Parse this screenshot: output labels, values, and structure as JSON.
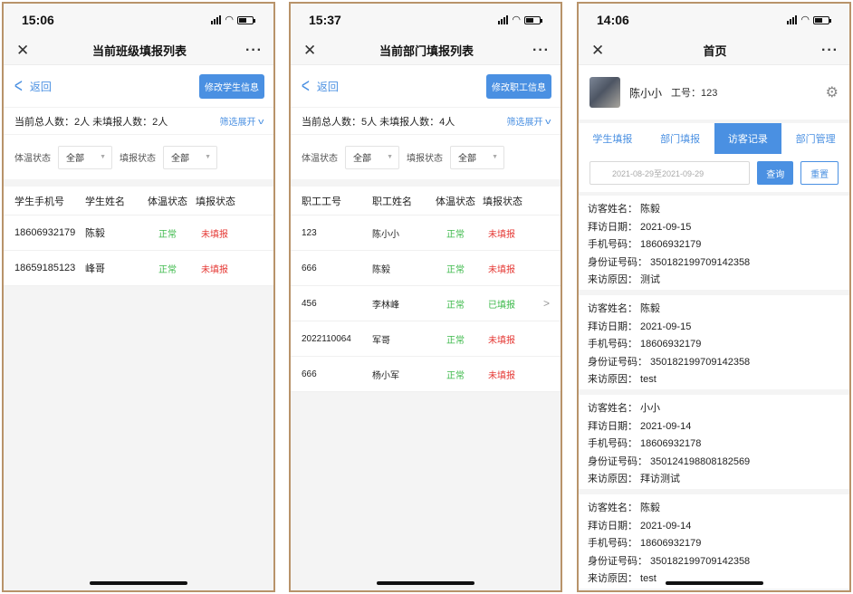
{
  "screens": [
    {
      "time": "15:06",
      "title": "当前班级填报列表",
      "back_label": "返回",
      "action_label": "修改学生信息",
      "count_text": "当前总人数：2人  未填报人数：2人",
      "filter_toggle": "筛选展开",
      "filter_labels": [
        "体温状态",
        "填报状态"
      ],
      "filter_values": [
        "全部",
        "全部"
      ],
      "columns": [
        "学生手机号",
        "学生姓名",
        "体温状态",
        "填报状态"
      ],
      "rows": [
        {
          "phone": "18606932179",
          "name": "陈毅",
          "temp": "正常",
          "status": "未填报"
        },
        {
          "phone": "18659185123",
          "name": "峰哥",
          "temp": "正常",
          "status": "未填报"
        }
      ]
    },
    {
      "time": "15:37",
      "title": "当前部门填报列表",
      "back_label": "返回",
      "action_label": "修改职工信息",
      "count_text": "当前总人数：5人  未填报人数：4人",
      "filter_toggle": "筛选展开",
      "filter_labels": [
        "体温状态",
        "填报状态"
      ],
      "filter_values": [
        "全部",
        "全部"
      ],
      "columns": [
        "职工工号",
        "职工姓名",
        "体温状态",
        "填报状态"
      ],
      "rows": [
        {
          "id": "123",
          "name": "陈小小",
          "temp": "正常",
          "status": "未填报"
        },
        {
          "id": "666",
          "name": "陈毅",
          "temp": "正常",
          "status": "未填报"
        },
        {
          "id": "456",
          "name": "李林峰",
          "temp": "正常",
          "status": "已填报"
        },
        {
          "id": "2022110064",
          "name": "军哥",
          "temp": "正常",
          "status": "未填报"
        },
        {
          "id": "666",
          "name": "杨小军",
          "temp": "正常",
          "status": "未填报"
        }
      ]
    },
    {
      "time": "14:06",
      "title": "首页",
      "user_name": "陈小小",
      "user_id": "工号：123",
      "tabs": [
        "学生填报",
        "部门填报",
        "访客记录",
        "部门管理"
      ],
      "active_tab": "访客记录",
      "date_range": "2021-08-29至2021-09-29",
      "query_label": "查询",
      "reset_label": "重置",
      "records": [
        {
          "name": "访客姓名： 陈毅",
          "date": "拜访日期： 2021-09-15",
          "phone": "手机号码： 18606932179",
          "idcard": "身份证号码： 350182199709142358",
          "reason": "来访原因： 测试"
        },
        {
          "name": "访客姓名： 陈毅",
          "date": "拜访日期： 2021-09-15",
          "phone": "手机号码： 18606932179",
          "idcard": "身份证号码： 350182199709142358",
          "reason": "来访原因： test"
        },
        {
          "name": "访客姓名： 小小",
          "date": "拜访日期： 2021-09-14",
          "phone": "手机号码： 18606932178",
          "idcard": "身份证号码： 350124198808182569",
          "reason": "来访原因： 拜访测试"
        },
        {
          "name": "访客姓名： 陈毅",
          "date": "拜访日期： 2021-09-14",
          "phone": "手机号码： 18606932179",
          "idcard": "身份证号码： 350182199709142358",
          "reason": "来访原因： test"
        }
      ]
    }
  ],
  "colors": {
    "accent": "#4a90e2",
    "normal": "#3cb94a",
    "unfilled": "#e53935",
    "frame": "#b8936a"
  },
  "icons": [
    "close-icon",
    "more-icon",
    "back-arrow-icon",
    "chevron-down-icon",
    "chevron-right-icon",
    "gear-icon",
    "signal-icon",
    "wifi-icon",
    "battery-icon"
  ]
}
